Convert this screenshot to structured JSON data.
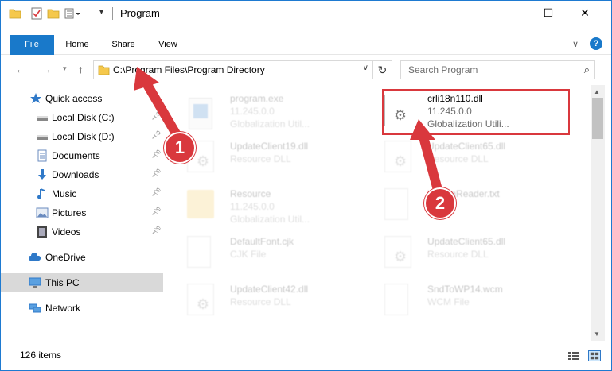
{
  "window": {
    "title": "Program",
    "controls": {
      "minimize": "—",
      "maximize": "☐",
      "close": "✕"
    }
  },
  "ribbon": {
    "tabs": [
      {
        "label": "File"
      },
      {
        "label": "Home"
      },
      {
        "label": "Share"
      },
      {
        "label": "View"
      }
    ],
    "help": "?"
  },
  "address": {
    "path": "C:\\Program Files\\Program Directory",
    "search_placeholder": "Search Program"
  },
  "sidebar": {
    "items": [
      {
        "label": "Quick access",
        "icon": "star-icon"
      },
      {
        "label": "Local Disk (C:)",
        "icon": "drive-icon",
        "pinned": true
      },
      {
        "label": "Local Disk (D:)",
        "icon": "drive-icon",
        "pinned": true
      },
      {
        "label": "Documents",
        "icon": "documents-icon",
        "pinned": true
      },
      {
        "label": "Downloads",
        "icon": "downloads-icon",
        "pinned": true
      },
      {
        "label": "Music",
        "icon": "music-icon",
        "pinned": true
      },
      {
        "label": "Pictures",
        "icon": "pictures-icon",
        "pinned": true
      },
      {
        "label": "Videos",
        "icon": "videos-icon",
        "pinned": true
      },
      {
        "label": "OneDrive",
        "icon": "onedrive-icon"
      },
      {
        "label": "This PC",
        "icon": "pc-icon",
        "selected": true
      },
      {
        "label": "Network",
        "icon": "network-icon"
      }
    ]
  },
  "files": [
    {
      "name": "program.exe",
      "line1": "11.245.0.0",
      "line2": "Globalization Util...",
      "icon": "exe-icon",
      "faded": true
    },
    {
      "name": "crli18n110.dll",
      "line1": "11.245.0.0",
      "line2": "Globalization Utili...",
      "icon": "dll-gear-icon",
      "faded": false
    },
    {
      "name": "UpdateClient19.dll",
      "line1": "Resource DLL",
      "line2": "",
      "icon": "dll-gear-icon",
      "faded": true
    },
    {
      "name": "UpdateClient65.dll",
      "line1": "Resource DLL",
      "line2": "",
      "icon": "dll-gear-icon",
      "faded": true
    },
    {
      "name": "Resource",
      "line1": "11.245.0.0",
      "line2": "Globalization Util...",
      "icon": "folder-icon",
      "faded": true
    },
    {
      "name": "hiddenReader.txt",
      "line1": "",
      "line2": "",
      "icon": "text-file-icon",
      "faded": true
    },
    {
      "name": "DefaultFont.cjk",
      "line1": "CJK File",
      "line2": "",
      "icon": "blank-file-icon",
      "faded": true
    },
    {
      "name": "UpdateClient65.dll",
      "line1": "Resource DLL",
      "line2": "",
      "icon": "dll-gear-icon",
      "faded": true
    },
    {
      "name": "UpdateClient42.dll",
      "line1": "Resource DLL",
      "line2": "",
      "icon": "dll-gear-icon",
      "faded": true
    },
    {
      "name": "SndToWP14.wcm",
      "line1": "WCM File",
      "line2": "",
      "icon": "blank-file-icon",
      "faded": true
    }
  ],
  "status": {
    "item_count": "126 items"
  },
  "markers": [
    "1",
    "2"
  ],
  "colors": {
    "accent": "#1979ca",
    "marker": "#d9383d",
    "selected_bg": "#d9d9d9"
  }
}
